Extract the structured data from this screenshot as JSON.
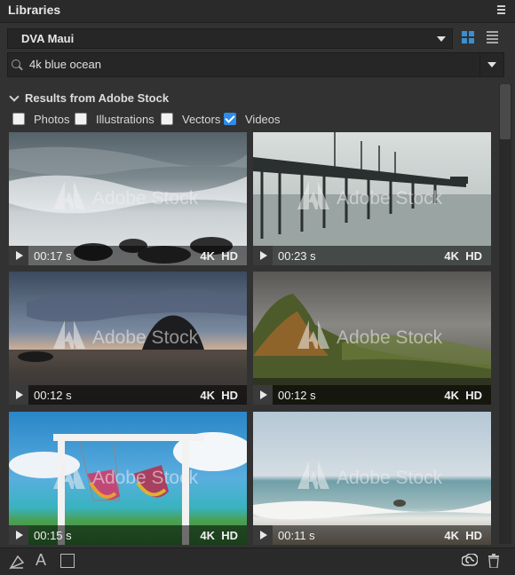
{
  "title": "Libraries",
  "library": {
    "selected": "DVA Maui"
  },
  "search": {
    "value": "4k blue ocean",
    "placeholder": ""
  },
  "section": {
    "title": "Results from Adobe Stock"
  },
  "filters": [
    {
      "label": "Photos",
      "checked": false
    },
    {
      "label": "Illustrations",
      "checked": false
    },
    {
      "label": "Vectors",
      "checked": false
    },
    {
      "label": "Videos",
      "checked": true
    }
  ],
  "results": [
    {
      "duration": "00:17 s",
      "badge4k": "4K",
      "badgeHD": "HD",
      "watermark": "Adobe Stock"
    },
    {
      "duration": "00:23 s",
      "badge4k": "4K",
      "badgeHD": "HD",
      "watermark": "Adobe Stock"
    },
    {
      "duration": "00:12 s",
      "badge4k": "4K",
      "badgeHD": "HD",
      "watermark": "Adobe Stock"
    },
    {
      "duration": "00:12 s",
      "badge4k": "4K",
      "badgeHD": "HD",
      "watermark": "Adobe Stock"
    },
    {
      "duration": "00:15 s",
      "badge4k": "4K",
      "badgeHD": "HD",
      "watermark": "Adobe Stock"
    },
    {
      "duration": "00:11 s",
      "badge4k": "4K",
      "badgeHD": "HD",
      "watermark": "Adobe Stock"
    }
  ],
  "footer": {
    "text_icon_glyph": "A"
  },
  "colors": {
    "accent": "#2d8ceb",
    "panel": "#323232"
  }
}
